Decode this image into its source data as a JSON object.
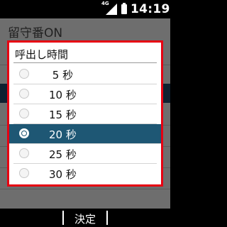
{
  "status_bar": {
    "network_label": "4G",
    "time": "14:19"
  },
  "background": {
    "title": "留守番ON"
  },
  "dialog": {
    "title": "呼出し時間",
    "options": [
      {
        "label": " 5 秒",
        "selected": false
      },
      {
        "label": "10 秒",
        "selected": false
      },
      {
        "label": "15 秒",
        "selected": false
      },
      {
        "label": "20 秒",
        "selected": true
      },
      {
        "label": "25 秒",
        "selected": false
      },
      {
        "label": "30 秒",
        "selected": false
      }
    ]
  },
  "softkeys": {
    "center": "決定"
  },
  "colors": {
    "accent_border": "#e60012",
    "selection": "#1e5774"
  }
}
